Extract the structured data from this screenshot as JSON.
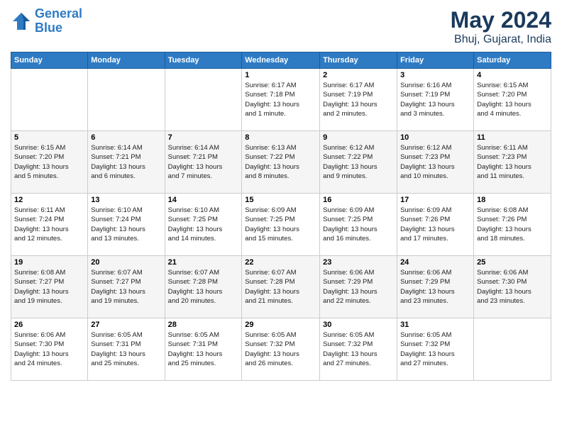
{
  "logo": {
    "line1": "General",
    "line2": "Blue"
  },
  "title": {
    "month_year": "May 2024",
    "location": "Bhuj, Gujarat, India"
  },
  "weekdays": [
    "Sunday",
    "Monday",
    "Tuesday",
    "Wednesday",
    "Thursday",
    "Friday",
    "Saturday"
  ],
  "weeks": [
    [
      {
        "day": "",
        "info": ""
      },
      {
        "day": "",
        "info": ""
      },
      {
        "day": "",
        "info": ""
      },
      {
        "day": "1",
        "info": "Sunrise: 6:17 AM\nSunset: 7:18 PM\nDaylight: 13 hours\nand 1 minute."
      },
      {
        "day": "2",
        "info": "Sunrise: 6:17 AM\nSunset: 7:19 PM\nDaylight: 13 hours\nand 2 minutes."
      },
      {
        "day": "3",
        "info": "Sunrise: 6:16 AM\nSunset: 7:19 PM\nDaylight: 13 hours\nand 3 minutes."
      },
      {
        "day": "4",
        "info": "Sunrise: 6:15 AM\nSunset: 7:20 PM\nDaylight: 13 hours\nand 4 minutes."
      }
    ],
    [
      {
        "day": "5",
        "info": "Sunrise: 6:15 AM\nSunset: 7:20 PM\nDaylight: 13 hours\nand 5 minutes."
      },
      {
        "day": "6",
        "info": "Sunrise: 6:14 AM\nSunset: 7:21 PM\nDaylight: 13 hours\nand 6 minutes."
      },
      {
        "day": "7",
        "info": "Sunrise: 6:14 AM\nSunset: 7:21 PM\nDaylight: 13 hours\nand 7 minutes."
      },
      {
        "day": "8",
        "info": "Sunrise: 6:13 AM\nSunset: 7:22 PM\nDaylight: 13 hours\nand 8 minutes."
      },
      {
        "day": "9",
        "info": "Sunrise: 6:12 AM\nSunset: 7:22 PM\nDaylight: 13 hours\nand 9 minutes."
      },
      {
        "day": "10",
        "info": "Sunrise: 6:12 AM\nSunset: 7:23 PM\nDaylight: 13 hours\nand 10 minutes."
      },
      {
        "day": "11",
        "info": "Sunrise: 6:11 AM\nSunset: 7:23 PM\nDaylight: 13 hours\nand 11 minutes."
      }
    ],
    [
      {
        "day": "12",
        "info": "Sunrise: 6:11 AM\nSunset: 7:24 PM\nDaylight: 13 hours\nand 12 minutes."
      },
      {
        "day": "13",
        "info": "Sunrise: 6:10 AM\nSunset: 7:24 PM\nDaylight: 13 hours\nand 13 minutes."
      },
      {
        "day": "14",
        "info": "Sunrise: 6:10 AM\nSunset: 7:25 PM\nDaylight: 13 hours\nand 14 minutes."
      },
      {
        "day": "15",
        "info": "Sunrise: 6:09 AM\nSunset: 7:25 PM\nDaylight: 13 hours\nand 15 minutes."
      },
      {
        "day": "16",
        "info": "Sunrise: 6:09 AM\nSunset: 7:25 PM\nDaylight: 13 hours\nand 16 minutes."
      },
      {
        "day": "17",
        "info": "Sunrise: 6:09 AM\nSunset: 7:26 PM\nDaylight: 13 hours\nand 17 minutes."
      },
      {
        "day": "18",
        "info": "Sunrise: 6:08 AM\nSunset: 7:26 PM\nDaylight: 13 hours\nand 18 minutes."
      }
    ],
    [
      {
        "day": "19",
        "info": "Sunrise: 6:08 AM\nSunset: 7:27 PM\nDaylight: 13 hours\nand 19 minutes."
      },
      {
        "day": "20",
        "info": "Sunrise: 6:07 AM\nSunset: 7:27 PM\nDaylight: 13 hours\nand 19 minutes."
      },
      {
        "day": "21",
        "info": "Sunrise: 6:07 AM\nSunset: 7:28 PM\nDaylight: 13 hours\nand 20 minutes."
      },
      {
        "day": "22",
        "info": "Sunrise: 6:07 AM\nSunset: 7:28 PM\nDaylight: 13 hours\nand 21 minutes."
      },
      {
        "day": "23",
        "info": "Sunrise: 6:06 AM\nSunset: 7:29 PM\nDaylight: 13 hours\nand 22 minutes."
      },
      {
        "day": "24",
        "info": "Sunrise: 6:06 AM\nSunset: 7:29 PM\nDaylight: 13 hours\nand 23 minutes."
      },
      {
        "day": "25",
        "info": "Sunrise: 6:06 AM\nSunset: 7:30 PM\nDaylight: 13 hours\nand 23 minutes."
      }
    ],
    [
      {
        "day": "26",
        "info": "Sunrise: 6:06 AM\nSunset: 7:30 PM\nDaylight: 13 hours\nand 24 minutes."
      },
      {
        "day": "27",
        "info": "Sunrise: 6:05 AM\nSunset: 7:31 PM\nDaylight: 13 hours\nand 25 minutes."
      },
      {
        "day": "28",
        "info": "Sunrise: 6:05 AM\nSunset: 7:31 PM\nDaylight: 13 hours\nand 25 minutes."
      },
      {
        "day": "29",
        "info": "Sunrise: 6:05 AM\nSunset: 7:32 PM\nDaylight: 13 hours\nand 26 minutes."
      },
      {
        "day": "30",
        "info": "Sunrise: 6:05 AM\nSunset: 7:32 PM\nDaylight: 13 hours\nand 27 minutes."
      },
      {
        "day": "31",
        "info": "Sunrise: 6:05 AM\nSunset: 7:32 PM\nDaylight: 13 hours\nand 27 minutes."
      },
      {
        "day": "",
        "info": ""
      }
    ]
  ]
}
